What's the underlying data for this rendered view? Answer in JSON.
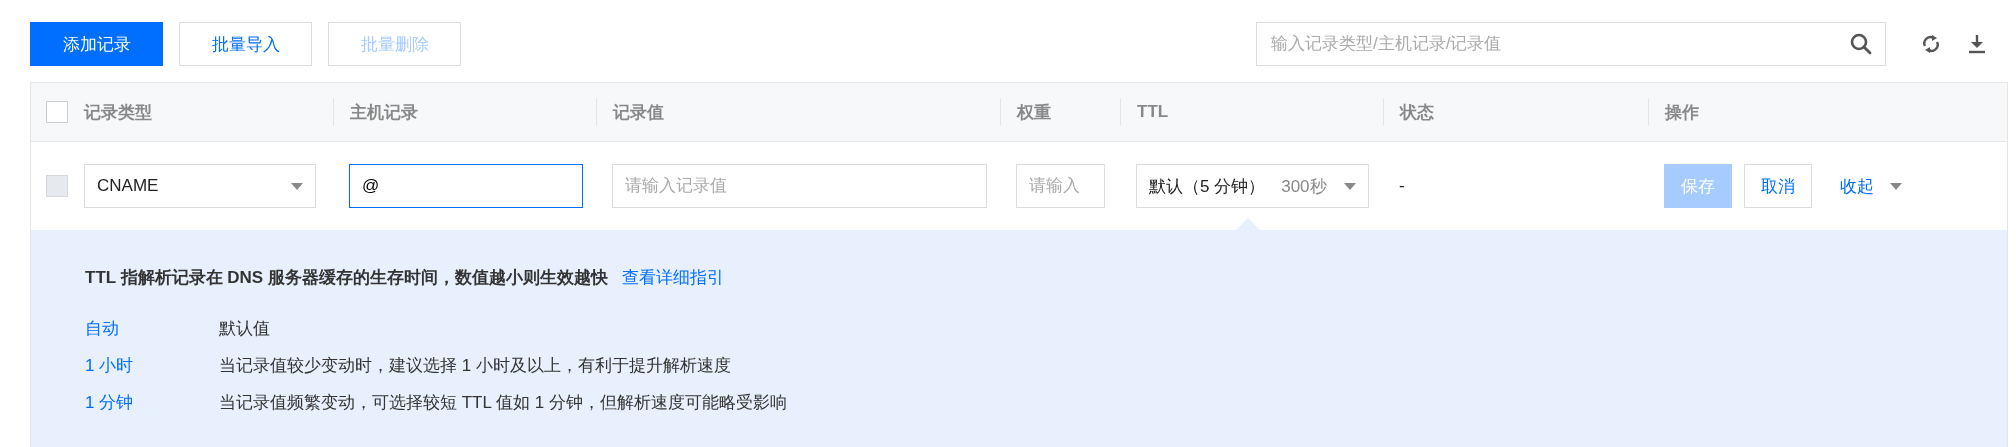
{
  "toolbar": {
    "buttons": [
      {
        "label": "添加记录",
        "kind": "primary",
        "disabled": false
      },
      {
        "label": "批量导入",
        "kind": "default",
        "disabled": false
      },
      {
        "label": "批量删除",
        "kind": "default",
        "disabled": true
      }
    ],
    "search": {
      "placeholder": "输入记录类型/主机记录/记录值"
    }
  },
  "table": {
    "select_all": {
      "checked": false
    },
    "columns": [
      "记录类型",
      "主机记录",
      "记录值",
      "权重",
      "TTL",
      "状态",
      "操作"
    ],
    "edit_row": {
      "checked": false,
      "disabled": true,
      "record_type": "CNAME",
      "host": {
        "value": "@",
        "focused": true
      },
      "value_placeholder": "请输入记录值",
      "weight_placeholder": "请输入",
      "ttl": {
        "label": "默认（5 分钟）",
        "seconds": "300秒"
      },
      "status": "-",
      "actions": [
        {
          "label": "保存",
          "kind": "primary",
          "disabled": true
        },
        {
          "label": "取消",
          "kind": "default",
          "disabled": false
        },
        {
          "label": "收起",
          "kind": "link",
          "disabled": false
        }
      ]
    }
  },
  "ttl_help": {
    "title": "TTL 指解析记录在 DNS 服务器缓存的生存时间，数值越小则生效越快",
    "link": "查看详细指引",
    "options": [
      {
        "label": "自动",
        "description": "默认值"
      },
      {
        "label": "1 小时",
        "description": "当记录值较少变动时，建议选择 1 小时及以上，有利于提升解析速度"
      },
      {
        "label": "1 分钟",
        "description": "当记录值频繁变动，可选择较短 TTL 值如 1 分钟，但解析速度可能略受影响"
      }
    ]
  }
}
